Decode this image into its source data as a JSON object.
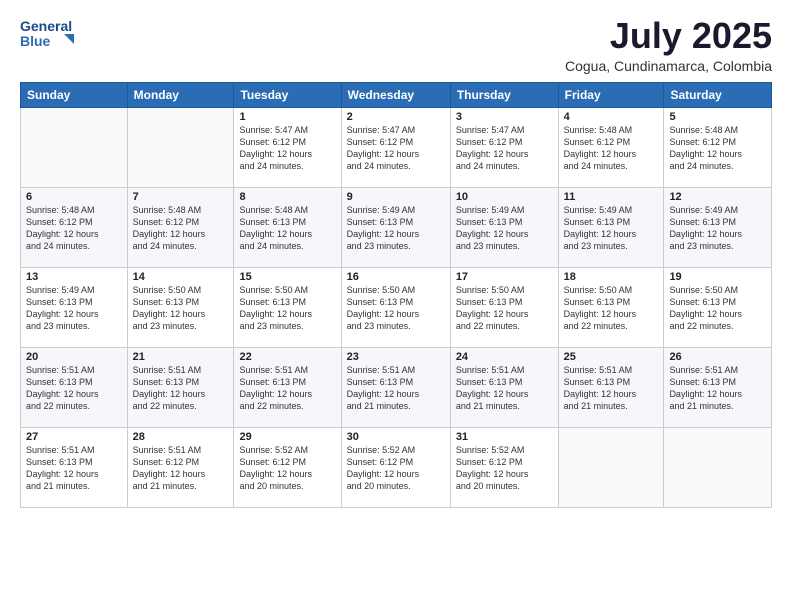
{
  "logo": {
    "line1": "General",
    "line2": "Blue"
  },
  "title": "July 2025",
  "location": "Cogua, Cundinamarca, Colombia",
  "weekdays": [
    "Sunday",
    "Monday",
    "Tuesday",
    "Wednesday",
    "Thursday",
    "Friday",
    "Saturday"
  ],
  "weeks": [
    [
      {
        "day": "",
        "info": ""
      },
      {
        "day": "",
        "info": ""
      },
      {
        "day": "1",
        "info": "Sunrise: 5:47 AM\nSunset: 6:12 PM\nDaylight: 12 hours\nand 24 minutes."
      },
      {
        "day": "2",
        "info": "Sunrise: 5:47 AM\nSunset: 6:12 PM\nDaylight: 12 hours\nand 24 minutes."
      },
      {
        "day": "3",
        "info": "Sunrise: 5:47 AM\nSunset: 6:12 PM\nDaylight: 12 hours\nand 24 minutes."
      },
      {
        "day": "4",
        "info": "Sunrise: 5:48 AM\nSunset: 6:12 PM\nDaylight: 12 hours\nand 24 minutes."
      },
      {
        "day": "5",
        "info": "Sunrise: 5:48 AM\nSunset: 6:12 PM\nDaylight: 12 hours\nand 24 minutes."
      }
    ],
    [
      {
        "day": "6",
        "info": "Sunrise: 5:48 AM\nSunset: 6:12 PM\nDaylight: 12 hours\nand 24 minutes."
      },
      {
        "day": "7",
        "info": "Sunrise: 5:48 AM\nSunset: 6:12 PM\nDaylight: 12 hours\nand 24 minutes."
      },
      {
        "day": "8",
        "info": "Sunrise: 5:48 AM\nSunset: 6:13 PM\nDaylight: 12 hours\nand 24 minutes."
      },
      {
        "day": "9",
        "info": "Sunrise: 5:49 AM\nSunset: 6:13 PM\nDaylight: 12 hours\nand 23 minutes."
      },
      {
        "day": "10",
        "info": "Sunrise: 5:49 AM\nSunset: 6:13 PM\nDaylight: 12 hours\nand 23 minutes."
      },
      {
        "day": "11",
        "info": "Sunrise: 5:49 AM\nSunset: 6:13 PM\nDaylight: 12 hours\nand 23 minutes."
      },
      {
        "day": "12",
        "info": "Sunrise: 5:49 AM\nSunset: 6:13 PM\nDaylight: 12 hours\nand 23 minutes."
      }
    ],
    [
      {
        "day": "13",
        "info": "Sunrise: 5:49 AM\nSunset: 6:13 PM\nDaylight: 12 hours\nand 23 minutes."
      },
      {
        "day": "14",
        "info": "Sunrise: 5:50 AM\nSunset: 6:13 PM\nDaylight: 12 hours\nand 23 minutes."
      },
      {
        "day": "15",
        "info": "Sunrise: 5:50 AM\nSunset: 6:13 PM\nDaylight: 12 hours\nand 23 minutes."
      },
      {
        "day": "16",
        "info": "Sunrise: 5:50 AM\nSunset: 6:13 PM\nDaylight: 12 hours\nand 23 minutes."
      },
      {
        "day": "17",
        "info": "Sunrise: 5:50 AM\nSunset: 6:13 PM\nDaylight: 12 hours\nand 22 minutes."
      },
      {
        "day": "18",
        "info": "Sunrise: 5:50 AM\nSunset: 6:13 PM\nDaylight: 12 hours\nand 22 minutes."
      },
      {
        "day": "19",
        "info": "Sunrise: 5:50 AM\nSunset: 6:13 PM\nDaylight: 12 hours\nand 22 minutes."
      }
    ],
    [
      {
        "day": "20",
        "info": "Sunrise: 5:51 AM\nSunset: 6:13 PM\nDaylight: 12 hours\nand 22 minutes."
      },
      {
        "day": "21",
        "info": "Sunrise: 5:51 AM\nSunset: 6:13 PM\nDaylight: 12 hours\nand 22 minutes."
      },
      {
        "day": "22",
        "info": "Sunrise: 5:51 AM\nSunset: 6:13 PM\nDaylight: 12 hours\nand 22 minutes."
      },
      {
        "day": "23",
        "info": "Sunrise: 5:51 AM\nSunset: 6:13 PM\nDaylight: 12 hours\nand 21 minutes."
      },
      {
        "day": "24",
        "info": "Sunrise: 5:51 AM\nSunset: 6:13 PM\nDaylight: 12 hours\nand 21 minutes."
      },
      {
        "day": "25",
        "info": "Sunrise: 5:51 AM\nSunset: 6:13 PM\nDaylight: 12 hours\nand 21 minutes."
      },
      {
        "day": "26",
        "info": "Sunrise: 5:51 AM\nSunset: 6:13 PM\nDaylight: 12 hours\nand 21 minutes."
      }
    ],
    [
      {
        "day": "27",
        "info": "Sunrise: 5:51 AM\nSunset: 6:13 PM\nDaylight: 12 hours\nand 21 minutes."
      },
      {
        "day": "28",
        "info": "Sunrise: 5:51 AM\nSunset: 6:12 PM\nDaylight: 12 hours\nand 21 minutes."
      },
      {
        "day": "29",
        "info": "Sunrise: 5:52 AM\nSunset: 6:12 PM\nDaylight: 12 hours\nand 20 minutes."
      },
      {
        "day": "30",
        "info": "Sunrise: 5:52 AM\nSunset: 6:12 PM\nDaylight: 12 hours\nand 20 minutes."
      },
      {
        "day": "31",
        "info": "Sunrise: 5:52 AM\nSunset: 6:12 PM\nDaylight: 12 hours\nand 20 minutes."
      },
      {
        "day": "",
        "info": ""
      },
      {
        "day": "",
        "info": ""
      }
    ]
  ]
}
